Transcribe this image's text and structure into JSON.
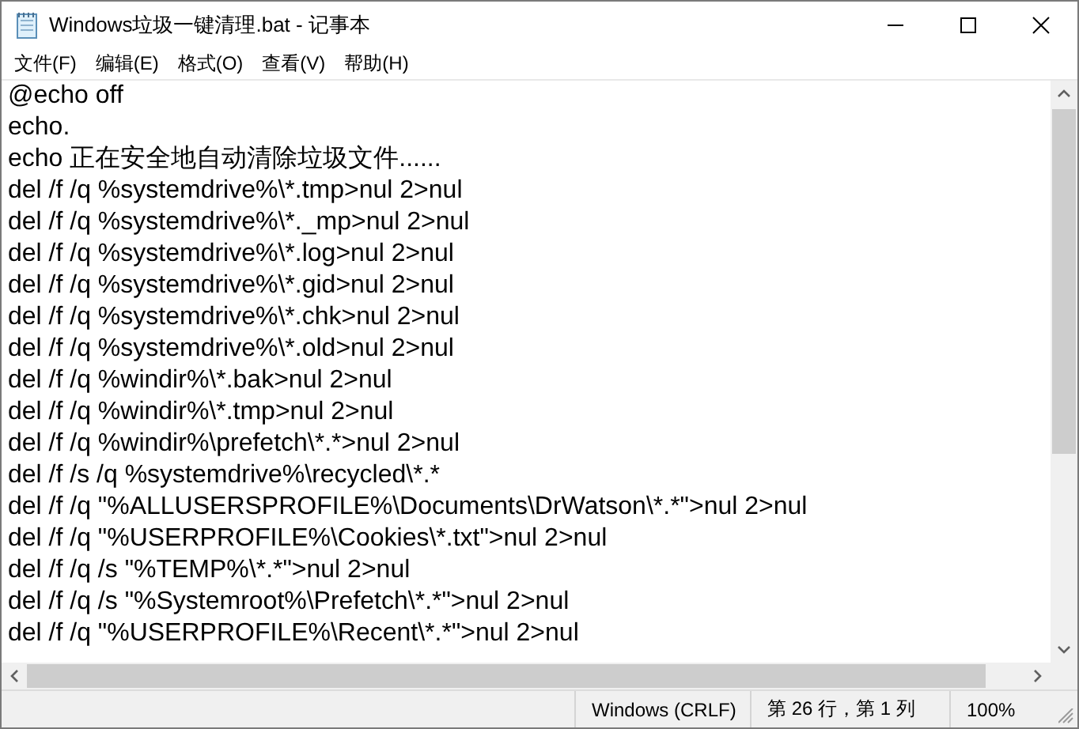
{
  "window": {
    "title": "Windows垃圾一键清理.bat - 记事本"
  },
  "menu": [
    "文件(F)",
    "编辑(E)",
    "格式(O)",
    "查看(V)",
    "帮助(H)"
  ],
  "editor": {
    "lines": [
      "@echo off",
      "echo.",
      "echo 正在安全地自动清除垃圾文件......",
      "del /f /q %systemdrive%\\*.tmp>nul 2>nul",
      "del /f /q %systemdrive%\\*._mp>nul 2>nul",
      "del /f /q %systemdrive%\\*.log>nul 2>nul",
      "del /f /q %systemdrive%\\*.gid>nul 2>nul",
      "del /f /q %systemdrive%\\*.chk>nul 2>nul",
      "del /f /q %systemdrive%\\*.old>nul 2>nul",
      "del /f /q %windir%\\*.bak>nul 2>nul",
      "del /f /q %windir%\\*.tmp>nul 2>nul",
      "del /f /q %windir%\\prefetch\\*.*>nul 2>nul",
      "del /f /s /q %systemdrive%\\recycled\\*.*",
      "del /f /q \"%ALLUSERSPROFILE%\\Documents\\DrWatson\\*.*\">nul 2>nul",
      "del /f /q \"%USERPROFILE%\\Cookies\\*.txt\">nul 2>nul",
      "del /f /q /s \"%TEMP%\\*.*\">nul 2>nul",
      "del /f /q /s \"%Systemroot%\\Prefetch\\*.*\">nul 2>nul",
      "del /f /q \"%USERPROFILE%\\Recent\\*.*\">nul 2>nul"
    ]
  },
  "status_bar": [
    "Windows (CRLF)",
    "第 26 行，第 1 列",
    "100%"
  ]
}
